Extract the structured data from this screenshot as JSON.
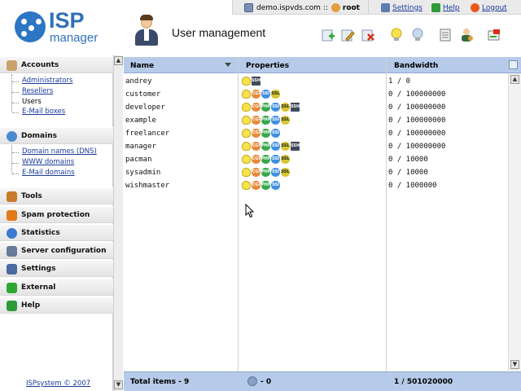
{
  "topbar": {
    "server": "demo.ispvds.com ::",
    "user": "root",
    "settings_label": "Settings",
    "help_label": "Help",
    "logout_label": "Logout"
  },
  "header": {
    "logo_top": "ISP",
    "logo_bottom": "manager",
    "page_title": "User management"
  },
  "toolbar": [
    "add-user-icon",
    "edit-user-icon",
    "delete-user-icon",
    "enable-icon",
    "disable-icon",
    "list-icon",
    "user-login-icon",
    "export-icon"
  ],
  "sidebar": {
    "sections": [
      {
        "label": "Accounts",
        "icon": "accounts-icon",
        "items": [
          {
            "label": "Administrators",
            "link": true
          },
          {
            "label": "Resellers",
            "link": true
          },
          {
            "label": "Users",
            "link": false
          },
          {
            "label": "E-Mail boxes",
            "link": true
          }
        ]
      },
      {
        "label": "Domains",
        "icon": "domains-icon",
        "items": [
          {
            "label": "Domain names (DNS)",
            "link": true
          },
          {
            "label": "WWW domains",
            "link": true
          },
          {
            "label": "E-Mail domains",
            "link": true
          }
        ]
      },
      {
        "label": "Tools",
        "icon": "tools-icon"
      },
      {
        "label": "Spam protection",
        "icon": "spam-icon"
      },
      {
        "label": "Statistics",
        "icon": "statistics-icon"
      },
      {
        "label": "Server configuration",
        "icon": "server-icon"
      },
      {
        "label": "Settings",
        "icon": "settings-icon"
      },
      {
        "label": "External",
        "icon": "external-icon"
      },
      {
        "label": "Help",
        "icon": "help-icon"
      }
    ],
    "copyright": "ISPsystem © 2007"
  },
  "table": {
    "columns": [
      "Name",
      "Properties",
      "Bandwidth"
    ],
    "rows": [
      {
        "name": "andrey",
        "props": [
          "bulb",
          "ssh"
        ],
        "bandwidth": "1 / 0"
      },
      {
        "name": "customer",
        "props": [
          "bulb",
          "cgi",
          "ssi",
          "ssl"
        ],
        "bandwidth": "0 / 100000000"
      },
      {
        "name": "developer",
        "props": [
          "bulb",
          "cgi",
          "php",
          "ssi",
          "ssl",
          "ssh"
        ],
        "bandwidth": "0 / 100000000"
      },
      {
        "name": "example",
        "props": [
          "bulb",
          "cgi",
          "php",
          "ssi",
          "ssl"
        ],
        "bandwidth": "0 / 100000000"
      },
      {
        "name": "freelancer",
        "props": [
          "bulb",
          "cgi",
          "php",
          "ssi"
        ],
        "bandwidth": "0 / 100000000"
      },
      {
        "name": "manager",
        "props": [
          "bulb",
          "cgi",
          "php",
          "ssi",
          "ssl",
          "ssh"
        ],
        "bandwidth": "0 / 100000000"
      },
      {
        "name": "pacman",
        "props": [
          "bulb",
          "cgi",
          "php",
          "ssi",
          "ssl"
        ],
        "bandwidth": "0 / 10000"
      },
      {
        "name": "sysadmin",
        "props": [
          "bulb",
          "cgi",
          "php",
          "ssi",
          "ssl"
        ],
        "bandwidth": "0 / 10000"
      },
      {
        "name": "wishmaster",
        "props": [
          "bulb",
          "cgi",
          "php",
          "ssi"
        ],
        "bandwidth": "0 / 1000000"
      }
    ],
    "prop_labels": {
      "bulb": "",
      "ssh": "SSH",
      "cgi": "CGI",
      "php": "PHP",
      "ssi": "SSI",
      "ssl": "SSL"
    },
    "footer": {
      "total": "Total items - 9",
      "props_total": "- 0",
      "bandwidth_total": "1 / 501020000"
    }
  }
}
